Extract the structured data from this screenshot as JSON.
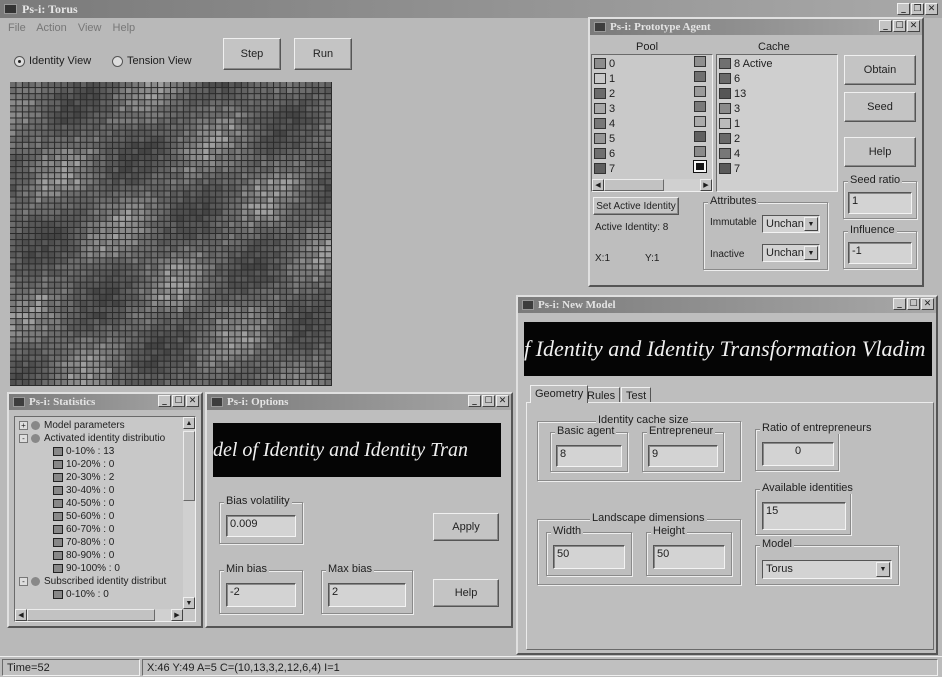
{
  "main": {
    "title": "Ps-i: Torus",
    "menu": [
      "File",
      "Action",
      "View",
      "Help"
    ],
    "radios": [
      {
        "label": "Identity View",
        "selected": true
      },
      {
        "label": "Tension View",
        "selected": false
      }
    ],
    "step_label": "Step",
    "run_label": "Run",
    "grid": {
      "rows": 50,
      "cols": 50,
      "palette": [
        "#444444",
        "#4e4e4e",
        "#585858",
        "#626262",
        "#6c6c6c",
        "#7a7a7a",
        "#8a8a8a",
        "#9e9e9e"
      ]
    }
  },
  "prototype": {
    "title": "Ps-i: Prototype Agent",
    "pool_label": "Pool",
    "cache_label": "Cache",
    "pool_items": [
      "0",
      "1",
      "2",
      "3",
      "4",
      "5",
      "6",
      "7"
    ],
    "pool_colors": [
      "#8d8d8d",
      "#c8c8c8",
      "#6b6b6b",
      "#a7a7a7",
      "#777777",
      "#959595",
      "#6f6f6f",
      "#5f5f5f"
    ],
    "mid_colors": [
      "#8f8f8f",
      "#707070",
      "#9a9a9a",
      "#7a7a7a",
      "#aaaaaa",
      "#606060",
      "#8a8a8a",
      "#141414"
    ],
    "cache_items": [
      "8 Active",
      "6",
      "13",
      "3",
      "1",
      "2",
      "4",
      "7"
    ],
    "cache_colors": [
      "#707070",
      "#6a6a6a",
      "#565656",
      "#8b8b8b",
      "#bbbbbb",
      "#6a6a6a",
      "#777777",
      "#5a5a5a"
    ],
    "obtain_label": "Obtain",
    "seed_label": "Seed",
    "help_label": "Help",
    "seed_ratio_label": "Seed ratio",
    "seed_ratio_value": "1",
    "influence_label": "Influence",
    "influence_value": "-1",
    "set_active_label": "Set Active Identity",
    "active_identity_text": "Active Identity: 8",
    "x_text": "X:1",
    "y_text": "Y:1",
    "attributes_label": "Attributes",
    "immutable_label": "Immutable",
    "immutable_value": "Unchanc",
    "inactive_label": "Inactive",
    "inactive_value": "Unchanc"
  },
  "new_model": {
    "title": "Ps-i: New Model",
    "banner_text": "f Identity and Identity Transformation  Vladim",
    "tabs": [
      "Geometry",
      "Rules",
      "Test"
    ],
    "identity_cache_label": "Identity cache size",
    "basic_agent_label": "Basic agent",
    "basic_agent_value": "8",
    "entrepreneur_label": "Entrepreneur",
    "entrepreneur_value": "9",
    "ratio_label": "Ratio of entrepreneurs",
    "ratio_value": "0",
    "available_label": "Available identities",
    "available_value": "15",
    "landscape_label": "Landscape dimensions",
    "width_label": "Width",
    "width_value": "50",
    "height_label": "Height",
    "height_value": "50",
    "model_label": "Model",
    "model_value": "Torus"
  },
  "statistics": {
    "title": "Ps-i: Statistics",
    "tree": [
      {
        "text": "Model parameters",
        "level": 0,
        "box": "+"
      },
      {
        "text": "Activated identity distributio",
        "level": 0,
        "box": "-"
      },
      {
        "text": "0-10% : 13",
        "level": 1
      },
      {
        "text": "10-20% : 0",
        "level": 1
      },
      {
        "text": "20-30% : 2",
        "level": 1
      },
      {
        "text": "30-40% : 0",
        "level": 1
      },
      {
        "text": "40-50% : 0",
        "level": 1
      },
      {
        "text": "50-60% : 0",
        "level": 1
      },
      {
        "text": "60-70% : 0",
        "level": 1
      },
      {
        "text": "70-80% : 0",
        "level": 1
      },
      {
        "text": "80-90% : 0",
        "level": 1
      },
      {
        "text": "90-100% : 0",
        "level": 1
      },
      {
        "text": "Subscribed identity distribut",
        "level": 0,
        "box": "-"
      },
      {
        "text": "0-10% : 0",
        "level": 1
      }
    ]
  },
  "options": {
    "title": "Ps-i: Options",
    "banner_text": "del of Identity and Identity Tran",
    "bias_volatility_label": "Bias volatility",
    "bias_volatility_value": "0.009",
    "apply_label": "Apply",
    "min_bias_label": "Min bias",
    "min_bias_value": "-2",
    "max_bias_label": "Max bias",
    "max_bias_value": "2",
    "help_label": "Help"
  },
  "status": {
    "time": "Time=52",
    "info": "X:46 Y:49 A=5 C=(10,13,3,2,12,6,4) I=1"
  }
}
